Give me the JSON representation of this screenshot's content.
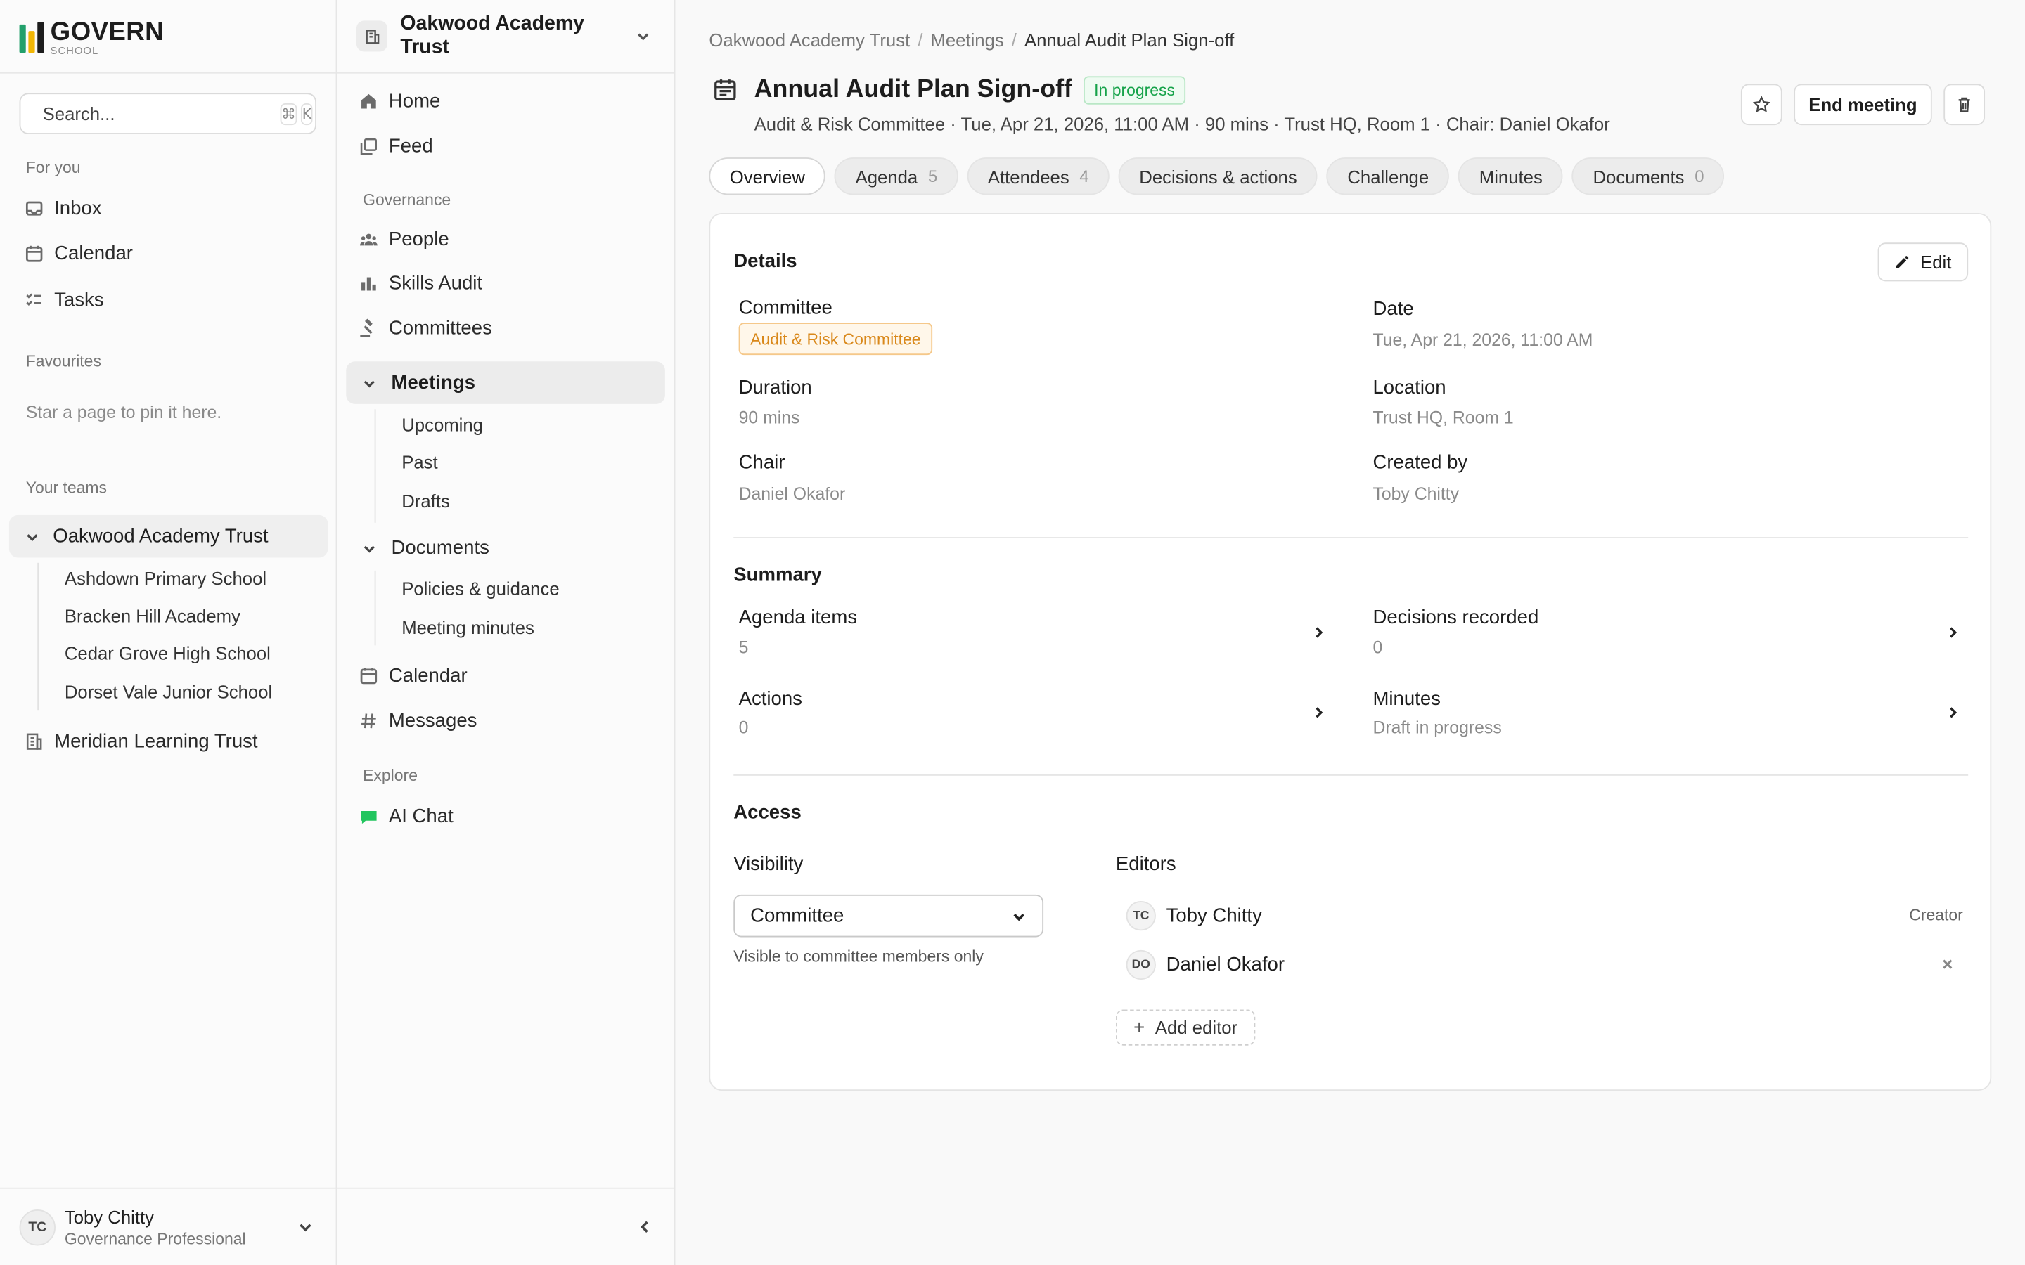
{
  "brand": {
    "name": "GOVERN",
    "sub": "SCHOOL",
    "colors": [
      "#22a06b",
      "#f2b705",
      "#1d1d1d"
    ]
  },
  "search": {
    "placeholder": "Search...",
    "shortcut_mod": "⌘",
    "shortcut_key": "K"
  },
  "left_nav": {
    "for_you_label": "For you",
    "for_you": [
      {
        "label": "Inbox",
        "icon": "inbox-icon"
      },
      {
        "label": "Calendar",
        "icon": "calendar-icon"
      },
      {
        "label": "Tasks",
        "icon": "tasks-icon"
      }
    ],
    "favourites_label": "Favourites",
    "favourites_empty": "Star a page to pin it here.",
    "teams_label": "Your teams",
    "active_team": "Oakwood Academy Trust",
    "schools": [
      "Ashdown Primary School",
      "Bracken Hill Academy",
      "Cedar Grove High School",
      "Dorset Vale Junior School"
    ],
    "other_team": "Meridian Learning Trust"
  },
  "user": {
    "initials": "TC",
    "name": "Toby Chitty",
    "role": "Governance Professional"
  },
  "mid_nav": {
    "org": "Oakwood Academy Trust",
    "top": [
      {
        "label": "Home",
        "icon": "home-icon"
      },
      {
        "label": "Feed",
        "icon": "feed-icon"
      }
    ],
    "governance_label": "Governance",
    "governance": [
      {
        "label": "People",
        "icon": "people-icon"
      },
      {
        "label": "Skills Audit",
        "icon": "bar-chart-icon"
      },
      {
        "label": "Committees",
        "icon": "gavel-icon"
      }
    ],
    "meetings": "Meetings",
    "meetings_sub": [
      "Upcoming",
      "Past",
      "Drafts"
    ],
    "documents": "Documents",
    "documents_sub": [
      "Policies & guidance",
      "Meeting minutes"
    ],
    "after": [
      {
        "label": "Calendar",
        "icon": "calendar-icon"
      },
      {
        "label": "Messages",
        "icon": "hash-icon"
      }
    ],
    "explore_label": "Explore",
    "ai_chat": "AI Chat"
  },
  "meeting": {
    "breadcrumb": [
      "Oakwood Academy Trust",
      "Meetings",
      "Annual Audit Plan Sign-off"
    ],
    "title": "Annual Audit Plan Sign-off",
    "status": "In progress",
    "subline": "Audit & Risk Committee · Tue, Apr 21, 2026, 11:00 AM · 90 mins · Trust HQ, Room 1 · Chair: Daniel Okafor",
    "end_button": "End meeting",
    "tabs": [
      {
        "label": "Overview",
        "count": ""
      },
      {
        "label": "Agenda",
        "count": "5"
      },
      {
        "label": "Attendees",
        "count": "4"
      },
      {
        "label": "Decisions & actions",
        "count": ""
      },
      {
        "label": "Challenge",
        "count": ""
      },
      {
        "label": "Minutes",
        "count": ""
      },
      {
        "label": "Documents",
        "count": "0"
      }
    ],
    "details": {
      "heading": "Details",
      "edit": "Edit",
      "committee_label": "Committee",
      "committee": "Audit & Risk Committee",
      "date_label": "Date",
      "date": "Tue, Apr 21, 2026, 11:00 AM",
      "duration_label": "Duration",
      "duration": "90 mins",
      "location_label": "Location",
      "location": "Trust HQ, Room 1",
      "chair_label": "Chair",
      "chair": "Daniel Okafor",
      "created_label": "Created by",
      "created_by": "Toby Chitty"
    },
    "summary": {
      "heading": "Summary",
      "agenda_label": "Agenda items",
      "agenda": "5",
      "decisions_label": "Decisions recorded",
      "decisions": "0",
      "actions_label": "Actions",
      "actions": "0",
      "minutes_label": "Minutes",
      "minutes": "Draft in progress"
    },
    "access": {
      "heading": "Access",
      "visibility_label": "Visibility",
      "visibility": "Committee",
      "visibility_help": "Visible to committee members only",
      "editors_label": "Editors",
      "editors": [
        {
          "initials": "TC",
          "name": "Toby Chitty",
          "role": "Creator"
        },
        {
          "initials": "DO",
          "name": "Daniel Okafor",
          "role": ""
        }
      ],
      "add_editor": "Add editor"
    }
  }
}
